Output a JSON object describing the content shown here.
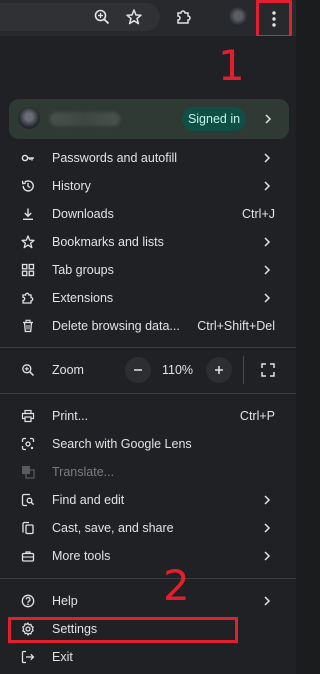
{
  "colors": {
    "toolbar_bg": "#28292c",
    "menu_bg": "#202124",
    "text": "#e3e3e3",
    "disabled_text": "#7a7b7e",
    "profile_card": "#2f3a35",
    "signed_badge_bg": "#0f4f46",
    "annotation_red": "#e0202f"
  },
  "toolbar": {
    "icons": [
      "zoom-icon",
      "star-icon",
      "extensions-icon",
      "avatar",
      "kebab-menu-icon"
    ]
  },
  "annotations": {
    "step1": "1",
    "step2": "2"
  },
  "profile": {
    "signed_in_label": "Signed in"
  },
  "menu": {
    "group1": [
      {
        "label": "Passwords and autofill",
        "icon": "key-icon",
        "submenu": true
      },
      {
        "label": "History",
        "icon": "history-icon",
        "submenu": true
      },
      {
        "label": "Downloads",
        "icon": "download-icon",
        "shortcut": "Ctrl+J"
      },
      {
        "label": "Bookmarks and lists",
        "icon": "star-icon",
        "submenu": true
      },
      {
        "label": "Tab groups",
        "icon": "tab-groups-icon",
        "submenu": true
      },
      {
        "label": "Extensions",
        "icon": "extensions-icon",
        "submenu": true
      },
      {
        "label": "Delete browsing data...",
        "icon": "trash-icon",
        "shortcut": "Ctrl+Shift+Del"
      }
    ],
    "zoom": {
      "label": "Zoom",
      "value": "110%",
      "minus": "−",
      "plus": "+"
    },
    "group2": [
      {
        "label": "Print...",
        "icon": "print-icon",
        "shortcut": "Ctrl+P"
      },
      {
        "label": "Search with Google Lens",
        "icon": "lens-icon"
      },
      {
        "label": "Translate...",
        "icon": "translate-icon",
        "disabled": true
      },
      {
        "label": "Find and edit",
        "icon": "find-icon",
        "submenu": true
      },
      {
        "label": "Cast, save, and share",
        "icon": "cast-icon",
        "submenu": true
      },
      {
        "label": "More tools",
        "icon": "toolbox-icon",
        "submenu": true
      }
    ],
    "group3": [
      {
        "label": "Help",
        "icon": "help-icon",
        "submenu": true
      },
      {
        "label": "Settings",
        "icon": "gear-icon"
      },
      {
        "label": "Exit",
        "icon": "exit-icon"
      }
    ]
  }
}
